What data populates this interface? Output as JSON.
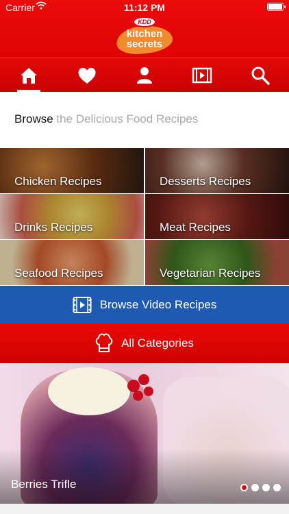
{
  "status_bar": {
    "carrier": "Carrier",
    "time": "11:12 PM"
  },
  "header": {
    "logo_brand": "KDD",
    "logo_line1": "kitchen",
    "logo_line2": "secrets"
  },
  "nav": [
    {
      "icon": "home-icon",
      "active": true
    },
    {
      "icon": "heart-icon",
      "active": false
    },
    {
      "icon": "user-icon",
      "active": false
    },
    {
      "icon": "film-icon",
      "active": false
    },
    {
      "icon": "search-icon",
      "active": false
    }
  ],
  "browse": {
    "prefix": "Browse",
    "suffix": "the Delicious Food Recipes"
  },
  "categories": [
    {
      "label": "Chicken Recipes"
    },
    {
      "label": "Desserts Recipes"
    },
    {
      "label": "Drinks Recipes"
    },
    {
      "label": "Meat Recipes"
    },
    {
      "label": "Seafood Recipes"
    },
    {
      "label": "Vegetarian Recipes"
    }
  ],
  "video_button": {
    "label": "Browse Video Recipes",
    "color": "#1e5bb0"
  },
  "categories_button": {
    "label": "All Categories",
    "color": "#e00404"
  },
  "featured": {
    "title": "Berries Trifle",
    "page_index": 0,
    "page_count": 4
  }
}
